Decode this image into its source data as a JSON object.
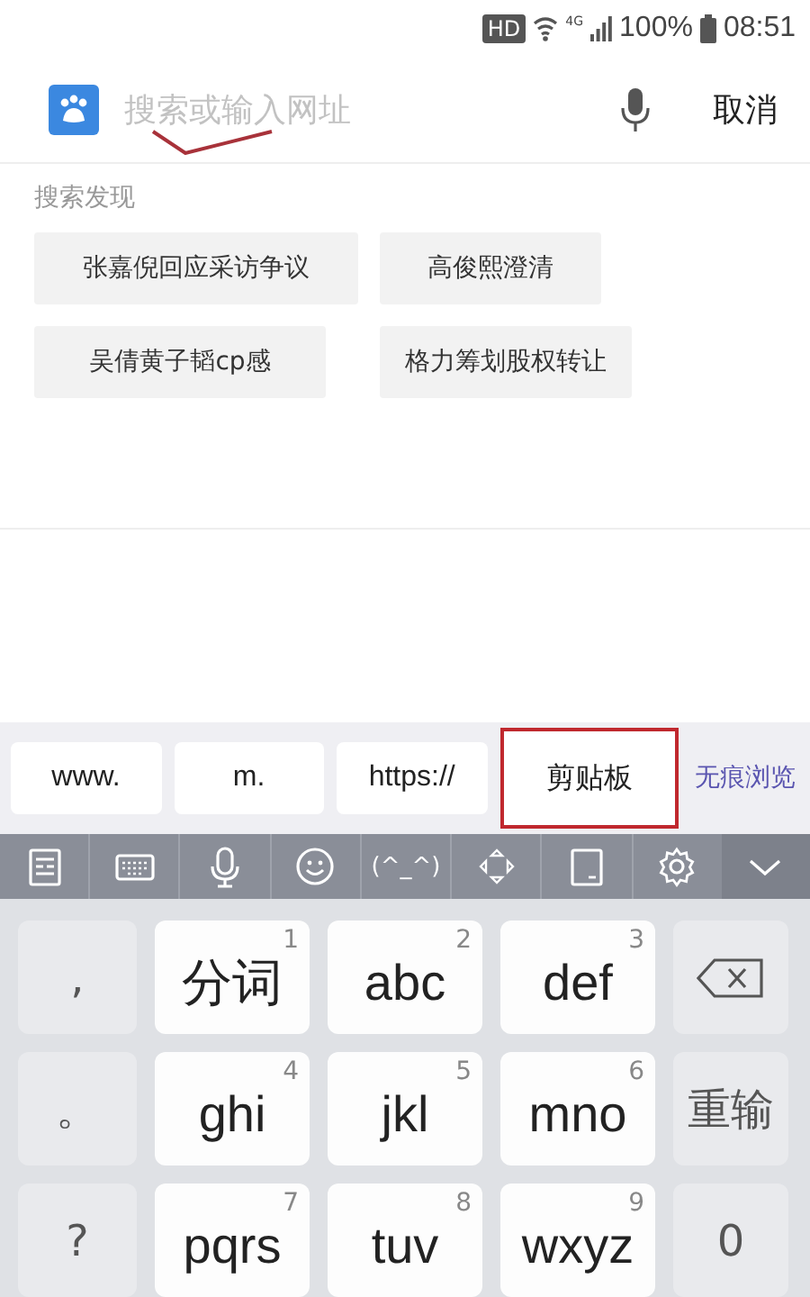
{
  "status_bar": {
    "hd": "HD",
    "network": "4G",
    "battery": "100%",
    "time": "08:51"
  },
  "search": {
    "placeholder": "搜索或输入网址",
    "check_mark": true,
    "cancel": "取消"
  },
  "discover": {
    "title": "搜索发现",
    "items": [
      {
        "label": "张嘉倪回应采访争议"
      },
      {
        "label": "高俊熙澄清"
      },
      {
        "label": "吴倩黄子韬cp感"
      },
      {
        "label": "格力筹划股权转让"
      }
    ]
  },
  "shortcuts": [
    {
      "label": "www.",
      "kind": "chip",
      "highlighted": false
    },
    {
      "label": "m.",
      "kind": "chip",
      "highlighted": false
    },
    {
      "label": "https://",
      "kind": "chip",
      "highlighted": false
    },
    {
      "label": "剪贴板",
      "kind": "chip",
      "highlighted": true
    },
    {
      "label": "无痕浏览",
      "kind": "link",
      "highlighted": false
    }
  ],
  "toolbar": [
    {
      "kind": "notes"
    },
    {
      "kind": "keyboard"
    },
    {
      "kind": "mic"
    },
    {
      "kind": "emoji"
    },
    {
      "kind": "kaomoji",
      "label": "(^_^)"
    },
    {
      "kind": "cursor"
    },
    {
      "kind": "clipboard"
    },
    {
      "kind": "settings"
    },
    {
      "kind": "collapse"
    }
  ],
  "keys": [
    {
      "kind": "symbol",
      "label": ","
    },
    {
      "kind": "letter",
      "label": "分词",
      "digit": "1"
    },
    {
      "kind": "letter",
      "label": "abc",
      "digit": "2"
    },
    {
      "kind": "letter",
      "label": "def",
      "digit": "3"
    },
    {
      "kind": "backspace"
    },
    {
      "kind": "symbol",
      "label": "。"
    },
    {
      "kind": "letter",
      "label": "ghi",
      "digit": "4"
    },
    {
      "kind": "letter",
      "label": "jkl",
      "digit": "5"
    },
    {
      "kind": "letter",
      "label": "mno",
      "digit": "6"
    },
    {
      "kind": "function",
      "label": "重输"
    },
    {
      "kind": "symbol",
      "label": "?"
    },
    {
      "kind": "letter",
      "label": "pqrs",
      "digit": "7"
    },
    {
      "kind": "letter",
      "label": "tuv",
      "digit": "8"
    },
    {
      "kind": "letter",
      "label": "wxyz",
      "digit": "9"
    },
    {
      "kind": "function",
      "label": "0"
    }
  ]
}
